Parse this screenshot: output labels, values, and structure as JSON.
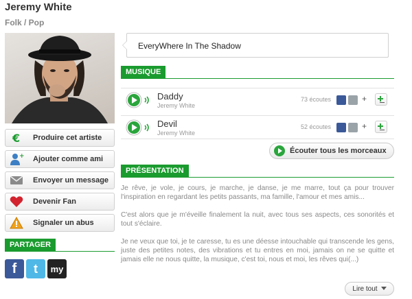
{
  "artist": {
    "name": "Jeremy White",
    "genre": "Folk / Pop",
    "status": "EveryWhere In The Shadow"
  },
  "actions": [
    {
      "label": "Produire cet artiste",
      "icon": "euro-icon"
    },
    {
      "label": "Ajouter comme ami",
      "icon": "add-friend-icon"
    },
    {
      "label": "Envoyer un message",
      "icon": "envelope-icon"
    },
    {
      "label": "Devenir Fan",
      "icon": "heart-icon"
    },
    {
      "label": "Signaler un abus",
      "icon": "warning-icon"
    }
  ],
  "share": {
    "title": "PARTAGER",
    "networks": [
      {
        "icon": "facebook-icon",
        "glyph": "f"
      },
      {
        "icon": "twitter-icon",
        "glyph": "t"
      },
      {
        "icon": "myspace-icon",
        "glyph": "my"
      }
    ]
  },
  "music": {
    "title": "MUSIQUE",
    "tracks": [
      {
        "title": "Daddy",
        "artist": "Jeremy White",
        "plays": "73 écoutes"
      },
      {
        "title": "Devil",
        "artist": "Jeremy White",
        "plays": "52 écoutes"
      }
    ],
    "listen_all_label": "Écouter tous les morceaux"
  },
  "presentation": {
    "title": "PRÉSENTATION",
    "paragraphs": [
      "Je rêve, je vole, je cours, je marche, je danse, je me marre, tout ça pour trouver l'inspiration en regardant les petits passants, ma famille, l'amour et mes amis...",
      "C'est alors que je m'éveille finalement la nuit, avec tous ses aspects, ces sonorités et tout s'éclaire.",
      "Je ne veux que toi, je te caresse, tu es une déesse intouchable qui transcende les gens, juste des petites notes, des vibrations et tu entres en moi, jamais on ne se quitte et jamais elle ne nous quitte, la musique, c'est toi, nous et moi, les rêves qui(...)"
    ],
    "read_more_label": "Lire tout"
  },
  "colors": {
    "accent": "#1a9b2e",
    "facebook": "#3b5998",
    "twitter": "#4fb8e7",
    "myspace": "#222222"
  }
}
